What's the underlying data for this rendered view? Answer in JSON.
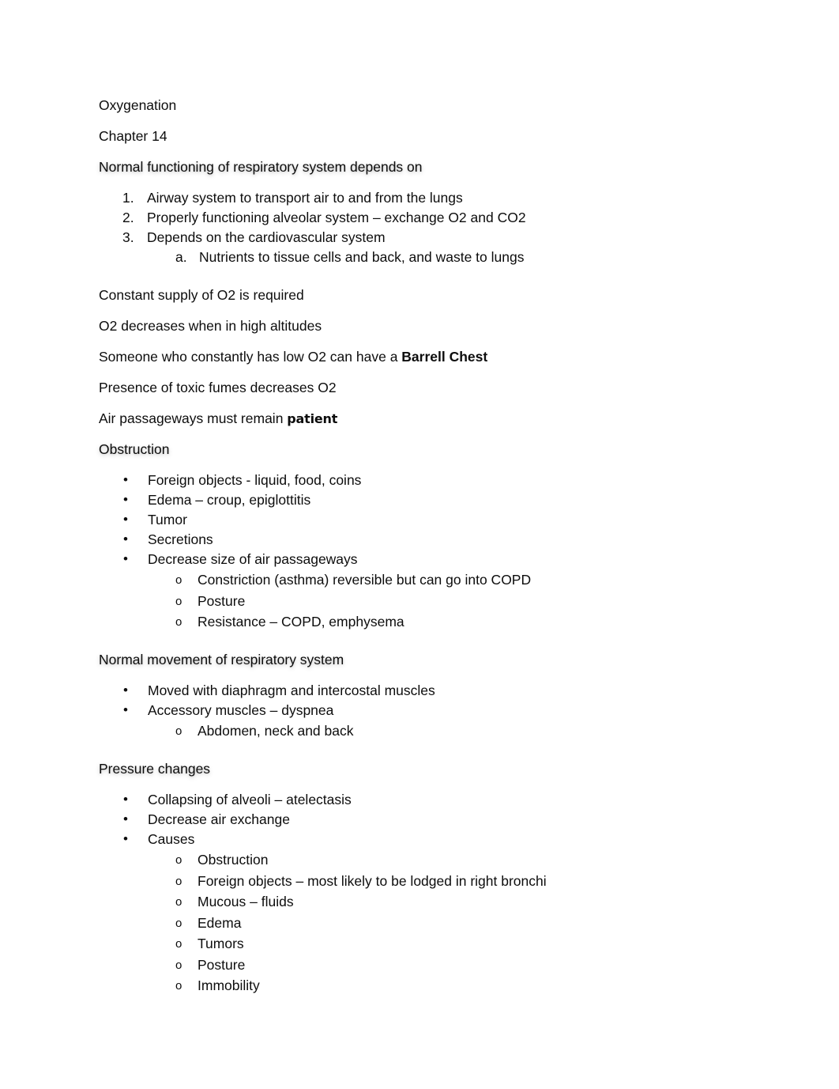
{
  "document": {
    "title": "Oxygenation",
    "chapter": "Chapter 14",
    "sections": {
      "depends_heading": "Normal functioning of respiratory system depends on",
      "depends_items": [
        {
          "marker": "1.",
          "text": "Airway system to transport air to and from the lungs"
        },
        {
          "marker": "2.",
          "text": "Properly functioning alveolar system – exchange O2 and CO2"
        },
        {
          "marker": "3.",
          "text": "Depends on the cardiovascular system"
        }
      ],
      "depends_subitems": [
        {
          "marker": "a.",
          "text": "Nutrients to tissue cells and back, and waste to lungs"
        }
      ],
      "statements": [
        "Constant supply of O2 is required",
        "O2 decreases when in high altitudes"
      ],
      "barrell_chest_line": {
        "prefix": "Someone who constantly has low O2 can have a ",
        "emphasis": "Barrell Chest"
      },
      "toxic_fumes_line": "Presence of toxic fumes decreases O2",
      "patent_line": {
        "prefix": "Air passageways must remain ",
        "emphasis": "patient"
      },
      "obstruction_heading": "Obstruction",
      "obstruction_items": [
        "Foreign objects - liquid, food, coins",
        "Edema – croup, epiglottitis",
        "Tumor",
        "Secretions",
        "Decrease size of air passageways"
      ],
      "obstruction_subitems": [
        "Constriction (asthma) reversible but can go into COPD",
        "Posture",
        "Resistance – COPD, emphysema"
      ],
      "movement_heading": "Normal movement of respiratory system",
      "movement_items": [
        "Moved with diaphragm and intercostal muscles",
        "Accessory muscles – dyspnea"
      ],
      "movement_subitems": [
        "Abdomen, neck and back"
      ],
      "pressure_heading": "Pressure changes",
      "pressure_items": [
        "Collapsing of alveoli – atelectasis",
        "Decrease air exchange",
        "Causes"
      ],
      "pressure_subitems": [
        "Obstruction",
        "Foreign objects – most likely to be lodged in right bronchi",
        "Mucous – fluids",
        "Edema",
        "Tumors",
        "Posture",
        "Immobility"
      ]
    },
    "markers": {
      "bullet": "•",
      "circle": "o"
    }
  }
}
